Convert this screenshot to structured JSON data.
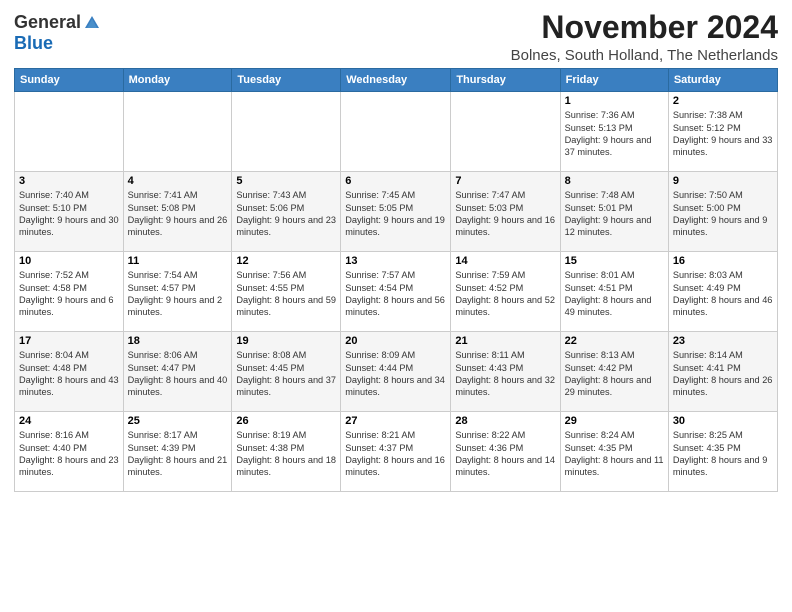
{
  "header": {
    "logo_general": "General",
    "logo_blue": "Blue",
    "month_title": "November 2024",
    "location": "Bolnes, South Holland, The Netherlands"
  },
  "weekdays": [
    "Sunday",
    "Monday",
    "Tuesday",
    "Wednesday",
    "Thursday",
    "Friday",
    "Saturday"
  ],
  "weeks": [
    [
      {
        "day": "",
        "sunrise": "",
        "sunset": "",
        "daylight": ""
      },
      {
        "day": "",
        "sunrise": "",
        "sunset": "",
        "daylight": ""
      },
      {
        "day": "",
        "sunrise": "",
        "sunset": "",
        "daylight": ""
      },
      {
        "day": "",
        "sunrise": "",
        "sunset": "",
        "daylight": ""
      },
      {
        "day": "",
        "sunrise": "",
        "sunset": "",
        "daylight": ""
      },
      {
        "day": "1",
        "sunrise": "Sunrise: 7:36 AM",
        "sunset": "Sunset: 5:13 PM",
        "daylight": "Daylight: 9 hours and 37 minutes."
      },
      {
        "day": "2",
        "sunrise": "Sunrise: 7:38 AM",
        "sunset": "Sunset: 5:12 PM",
        "daylight": "Daylight: 9 hours and 33 minutes."
      }
    ],
    [
      {
        "day": "3",
        "sunrise": "Sunrise: 7:40 AM",
        "sunset": "Sunset: 5:10 PM",
        "daylight": "Daylight: 9 hours and 30 minutes."
      },
      {
        "day": "4",
        "sunrise": "Sunrise: 7:41 AM",
        "sunset": "Sunset: 5:08 PM",
        "daylight": "Daylight: 9 hours and 26 minutes."
      },
      {
        "day": "5",
        "sunrise": "Sunrise: 7:43 AM",
        "sunset": "Sunset: 5:06 PM",
        "daylight": "Daylight: 9 hours and 23 minutes."
      },
      {
        "day": "6",
        "sunrise": "Sunrise: 7:45 AM",
        "sunset": "Sunset: 5:05 PM",
        "daylight": "Daylight: 9 hours and 19 minutes."
      },
      {
        "day": "7",
        "sunrise": "Sunrise: 7:47 AM",
        "sunset": "Sunset: 5:03 PM",
        "daylight": "Daylight: 9 hours and 16 minutes."
      },
      {
        "day": "8",
        "sunrise": "Sunrise: 7:48 AM",
        "sunset": "Sunset: 5:01 PM",
        "daylight": "Daylight: 9 hours and 12 minutes."
      },
      {
        "day": "9",
        "sunrise": "Sunrise: 7:50 AM",
        "sunset": "Sunset: 5:00 PM",
        "daylight": "Daylight: 9 hours and 9 minutes."
      }
    ],
    [
      {
        "day": "10",
        "sunrise": "Sunrise: 7:52 AM",
        "sunset": "Sunset: 4:58 PM",
        "daylight": "Daylight: 9 hours and 6 minutes."
      },
      {
        "day": "11",
        "sunrise": "Sunrise: 7:54 AM",
        "sunset": "Sunset: 4:57 PM",
        "daylight": "Daylight: 9 hours and 2 minutes."
      },
      {
        "day": "12",
        "sunrise": "Sunrise: 7:56 AM",
        "sunset": "Sunset: 4:55 PM",
        "daylight": "Daylight: 8 hours and 59 minutes."
      },
      {
        "day": "13",
        "sunrise": "Sunrise: 7:57 AM",
        "sunset": "Sunset: 4:54 PM",
        "daylight": "Daylight: 8 hours and 56 minutes."
      },
      {
        "day": "14",
        "sunrise": "Sunrise: 7:59 AM",
        "sunset": "Sunset: 4:52 PM",
        "daylight": "Daylight: 8 hours and 52 minutes."
      },
      {
        "day": "15",
        "sunrise": "Sunrise: 8:01 AM",
        "sunset": "Sunset: 4:51 PM",
        "daylight": "Daylight: 8 hours and 49 minutes."
      },
      {
        "day": "16",
        "sunrise": "Sunrise: 8:03 AM",
        "sunset": "Sunset: 4:49 PM",
        "daylight": "Daylight: 8 hours and 46 minutes."
      }
    ],
    [
      {
        "day": "17",
        "sunrise": "Sunrise: 8:04 AM",
        "sunset": "Sunset: 4:48 PM",
        "daylight": "Daylight: 8 hours and 43 minutes."
      },
      {
        "day": "18",
        "sunrise": "Sunrise: 8:06 AM",
        "sunset": "Sunset: 4:47 PM",
        "daylight": "Daylight: 8 hours and 40 minutes."
      },
      {
        "day": "19",
        "sunrise": "Sunrise: 8:08 AM",
        "sunset": "Sunset: 4:45 PM",
        "daylight": "Daylight: 8 hours and 37 minutes."
      },
      {
        "day": "20",
        "sunrise": "Sunrise: 8:09 AM",
        "sunset": "Sunset: 4:44 PM",
        "daylight": "Daylight: 8 hours and 34 minutes."
      },
      {
        "day": "21",
        "sunrise": "Sunrise: 8:11 AM",
        "sunset": "Sunset: 4:43 PM",
        "daylight": "Daylight: 8 hours and 32 minutes."
      },
      {
        "day": "22",
        "sunrise": "Sunrise: 8:13 AM",
        "sunset": "Sunset: 4:42 PM",
        "daylight": "Daylight: 8 hours and 29 minutes."
      },
      {
        "day": "23",
        "sunrise": "Sunrise: 8:14 AM",
        "sunset": "Sunset: 4:41 PM",
        "daylight": "Daylight: 8 hours and 26 minutes."
      }
    ],
    [
      {
        "day": "24",
        "sunrise": "Sunrise: 8:16 AM",
        "sunset": "Sunset: 4:40 PM",
        "daylight": "Daylight: 8 hours and 23 minutes."
      },
      {
        "day": "25",
        "sunrise": "Sunrise: 8:17 AM",
        "sunset": "Sunset: 4:39 PM",
        "daylight": "Daylight: 8 hours and 21 minutes."
      },
      {
        "day": "26",
        "sunrise": "Sunrise: 8:19 AM",
        "sunset": "Sunset: 4:38 PM",
        "daylight": "Daylight: 8 hours and 18 minutes."
      },
      {
        "day": "27",
        "sunrise": "Sunrise: 8:21 AM",
        "sunset": "Sunset: 4:37 PM",
        "daylight": "Daylight: 8 hours and 16 minutes."
      },
      {
        "day": "28",
        "sunrise": "Sunrise: 8:22 AM",
        "sunset": "Sunset: 4:36 PM",
        "daylight": "Daylight: 8 hours and 14 minutes."
      },
      {
        "day": "29",
        "sunrise": "Sunrise: 8:24 AM",
        "sunset": "Sunset: 4:35 PM",
        "daylight": "Daylight: 8 hours and 11 minutes."
      },
      {
        "day": "30",
        "sunrise": "Sunrise: 8:25 AM",
        "sunset": "Sunset: 4:35 PM",
        "daylight": "Daylight: 8 hours and 9 minutes."
      }
    ]
  ]
}
